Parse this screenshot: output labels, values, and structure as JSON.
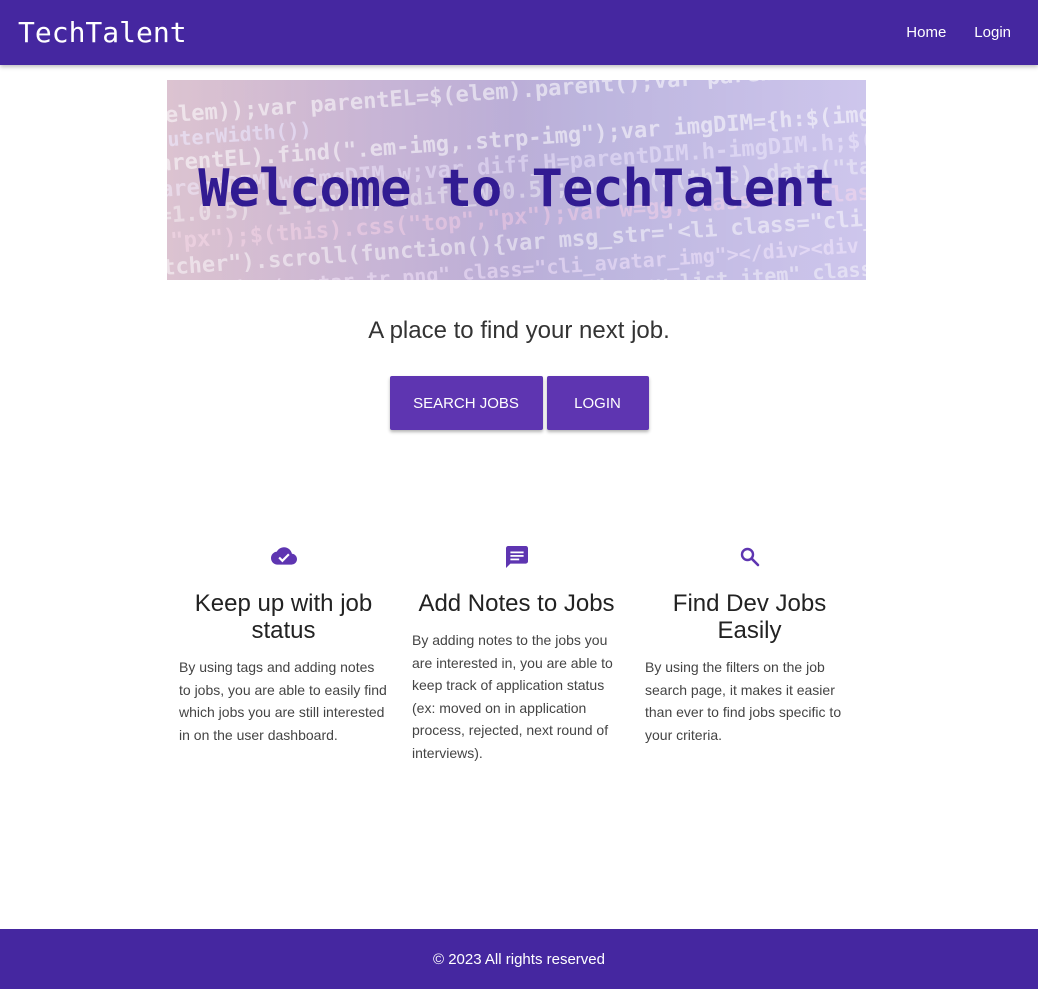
{
  "navbar": {
    "brand": "TechTalent",
    "links": [
      "Home",
      "Login"
    ]
  },
  "hero": {
    "title": "Welcome to TechTalent",
    "background_image": "code-on-screen"
  },
  "tagline": "A place to find your next job.",
  "cta": {
    "search_label": "SEARCH JOBS",
    "login_label": "LOGIN"
  },
  "features": [
    {
      "icon": "cloud-done-icon",
      "title": "Keep up with job status",
      "text": "By using tags and adding notes to jobs, you are able to easily find which jobs you are still interested in on the user dashboard."
    },
    {
      "icon": "chat-notes-icon",
      "title": "Add Notes to Jobs",
      "text": "By adding notes to the jobs you are interested in, you are able to keep track of application status (ex: moved on in application process, rejected, next round of interviews)."
    },
    {
      "icon": "search-icon",
      "title": "Find Dev Jobs Easily",
      "text": "By using the filters on the job search page, it makes it easier than ever to find jobs specific to your criteria."
    }
  ],
  "footer": {
    "text": "© 2023 All rights reserved"
  },
  "colors": {
    "primary": "#4527a0",
    "button": "#5e35b1",
    "icon": "#5e35b1"
  }
}
